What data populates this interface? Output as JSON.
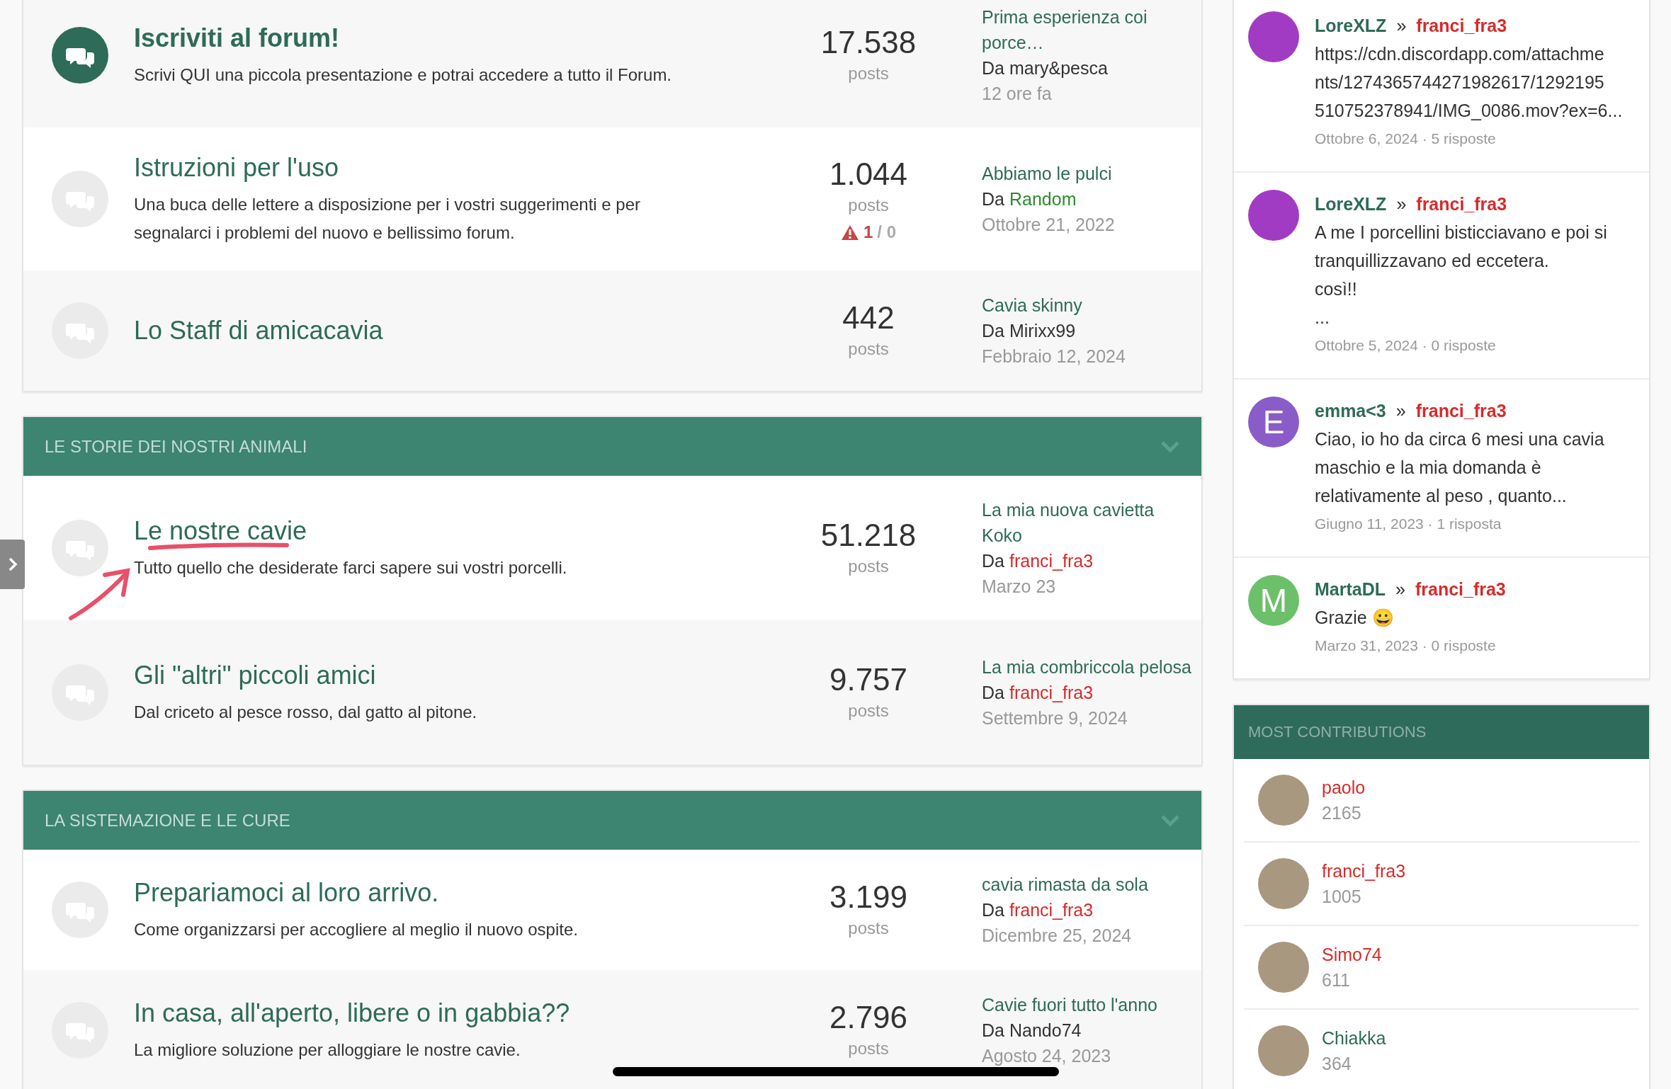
{
  "sections": [
    {
      "forums": [
        {
          "title": "Iscriviti al forum!",
          "bold": true,
          "unread": true,
          "description": "Scrivi QUI una piccola presentazione e potrai accedere a tutto il Forum.",
          "posts": "17.538",
          "posts_label": "posts",
          "last": {
            "title": "Prima esperienza coi porce…",
            "by": "Da",
            "author": "mary&pesca",
            "color": "#333333",
            "time": "12 ore fa"
          }
        },
        {
          "title": "Istruzioni per l'uso",
          "bold": false,
          "unread": false,
          "description": "Una buca delle lettere a disposizione per i vostri suggerimenti e per segnalarci i problemi del nuovo e bellissimo forum.",
          "posts": "1.044",
          "posts_label": "posts",
          "reports": {
            "open": "1",
            "rest": "/ 0"
          },
          "last": {
            "title": "Abbiamo le pulci",
            "by": "Da",
            "author": "Random",
            "color": "#2e8b2e",
            "time": "Ottobre 21, 2022"
          }
        },
        {
          "title": "Lo Staff di amicacavia",
          "bold": false,
          "unread": false,
          "posts": "442",
          "posts_label": "posts",
          "last": {
            "title": "Cavia skinny",
            "by": "Da",
            "author": "Mirixx99",
            "color": "#333333",
            "time": "Febbraio 12, 2024"
          }
        }
      ]
    },
    {
      "title": "LE STORIE DEI NOSTRI ANIMALI",
      "forums": [
        {
          "title": "Le nostre cavie",
          "bold": false,
          "unread": false,
          "description": "Tutto quello che desiderate farci sapere sui vostri porcelli.",
          "posts": "51.218",
          "posts_label": "posts",
          "last": {
            "title": "La mia nuova cavietta Koko",
            "by": "Da",
            "author": "franci_fra3",
            "color": "#d62b2b",
            "time": "Marzo 23"
          }
        },
        {
          "title": "Gli \"altri\" piccoli amici",
          "bold": false,
          "unread": false,
          "description": "Dal criceto al pesce rosso, dal gatto al pitone.",
          "posts": "9.757",
          "posts_label": "posts",
          "last": {
            "title": "La mia combriccola pelosa",
            "by": "Da",
            "author": "franci_fra3",
            "color": "#d62b2b",
            "time": "Settembre 9, 2024"
          }
        }
      ]
    },
    {
      "title": "LA SISTEMAZIONE E LE CURE",
      "forums": [
        {
          "title": "Prepariamoci al loro arrivo.",
          "bold": false,
          "unread": false,
          "description": "Come organizzarsi per accogliere al meglio il nuovo ospite.",
          "posts": "3.199",
          "posts_label": "posts",
          "last": {
            "title": "cavia rimasta da sola",
            "by": "Da",
            "author": "franci_fra3",
            "color": "#d62b2b",
            "time": "Dicembre 25, 2024"
          }
        },
        {
          "title": "In casa, all'aperto, libere o in gabbia??",
          "bold": false,
          "unread": false,
          "description": "La migliore soluzione per alloggiare le nostre cavie.",
          "posts": "2.796",
          "posts_label": "posts",
          "last": {
            "title": "Cavie fuori tutto l'anno",
            "by": "Da",
            "author": "Nando74",
            "color": "#333333",
            "time": "Agosto 24, 2023"
          }
        }
      ]
    }
  ],
  "recent_posts": [
    {
      "avatar": {
        "kind": "image",
        "color": "#a23bc4"
      },
      "author": "LoreXLZ",
      "separator": "»",
      "recipient": "franci_fra3",
      "lines": [
        "https://cdn.discordapp.com/attachme",
        "nts/1274365744271982617/1292195",
        "510752378941/IMG_0086.mov?ex=6..."
      ],
      "meta": "Ottobre 6, 2024 · 5 risposte"
    },
    {
      "avatar": {
        "kind": "image",
        "color": "#a23bc4"
      },
      "author": "LoreXLZ",
      "separator": "»",
      "recipient": "franci_fra3",
      "lines": [
        "A me I porcellini bisticciavano e poi si",
        "tranquillizzavano ed eccetera.",
        "così!!",
        "..."
      ],
      "meta": "Ottobre 5, 2024 · 0 risposte"
    },
    {
      "avatar": {
        "kind": "letter",
        "letter": "E",
        "color": "#8a5cc7"
      },
      "author": "emma<3",
      "separator": "»",
      "recipient": "franci_fra3",
      "lines": [
        "Ciao, io ho da circa 6 mesi una cavia",
        "maschio e la mia domanda è",
        "relativamente al peso , quanto..."
      ],
      "meta": "Giugno 11, 2023 · 1 risposta"
    },
    {
      "avatar": {
        "kind": "letter",
        "letter": "M",
        "color": "#6cc06a"
      },
      "author": "MartaDL",
      "separator": "»",
      "recipient": "franci_fra3",
      "lines": [
        "Grazie 😀"
      ],
      "meta": "Marzo 31, 2023 · 0 risposte"
    }
  ],
  "most_contributions": {
    "title": "MOST CONTRIBUTIONS",
    "items": [
      {
        "name": "paolo",
        "color": "#d62b2b",
        "count": "2165"
      },
      {
        "name": "franci_fra3",
        "color": "#d62b2b",
        "count": "1005"
      },
      {
        "name": "Simo74",
        "color": "#d62b2b",
        "count": "611"
      },
      {
        "name": "Chiakka",
        "color": "#2e6b58",
        "count": "364"
      }
    ]
  }
}
